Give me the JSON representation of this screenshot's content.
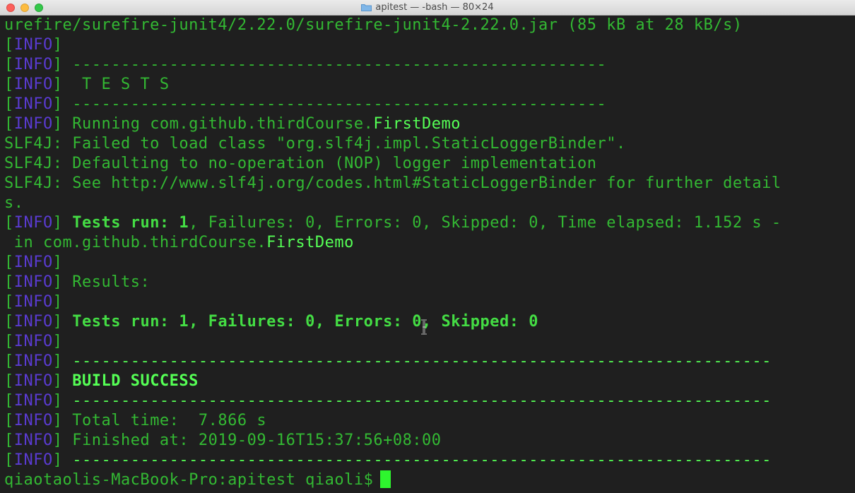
{
  "window": {
    "title": "apitest — -bash — 80×24",
    "folder_icon": "folder-icon"
  },
  "colors": {
    "background": "#1f1f1f",
    "text": "#33b933",
    "info_tag": "#5a3bd1",
    "highlight": "#55ff55",
    "cursor": "#2ef52e"
  },
  "terminal": {
    "lines": {
      "l0": "urefire/surefire-junit4/2.22.0/surefire-junit4-2.22.0.jar (85 kB at 28 kB/s)",
      "tag": "INFO",
      "open": "[",
      "close": "]",
      "dash_short": " -------------------------------------------------------",
      "tests_header": "  T E S T S",
      "running_prefix": " Running com.github.thirdCourse.",
      "class_name": "FirstDemo",
      "slf1": "SLF4J: Failed to load class \"org.slf4j.impl.StaticLoggerBinder\".",
      "slf2": "SLF4J: Defaulting to no-operation (NOP) logger implementation",
      "slf3": "SLF4J: See http://www.slf4j.org/codes.html#StaticLoggerBinder for further detail",
      "slf3_wrap": "s.",
      "tests_run_bold": " Tests run: 1",
      "tests_run_rest": ", Failures: 0, Errors: 0, Skipped: 0, Time elapsed: 1.152 s -",
      "in_prefix": " in com.github.thirdCourse.",
      "results": " Results:",
      "summary": " Tests run: 1, Failures: 0, Errors: 0, Skipped: 0",
      "dash_long": " ------------------------------------------------------------------------",
      "build": " BUILD SUCCESS",
      "total_time": " Total time:  7.866 s",
      "finished": " Finished at: 2019-09-16T15:37:56+08:00",
      "prompt": "qiaotaolis-MacBook-Pro:apitest qiaoli$"
    }
  }
}
